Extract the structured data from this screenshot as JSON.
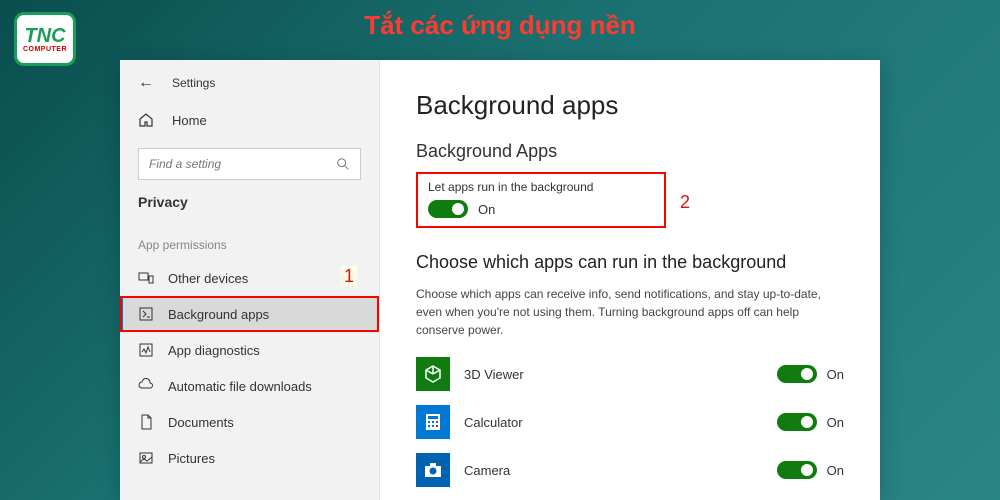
{
  "article": {
    "title": "Tắt các ứng dụng nền",
    "logo_main": "TNC",
    "logo_sub": "COMPUTER"
  },
  "annotations": {
    "step1": "1",
    "step2": "2"
  },
  "sidebar": {
    "back_label": "Settings",
    "home_label": "Home",
    "search_placeholder": "Find a setting",
    "category": "Privacy",
    "section": "App permissions",
    "items": [
      {
        "label": "Other devices"
      },
      {
        "label": "Background apps"
      },
      {
        "label": "App diagnostics"
      },
      {
        "label": "Automatic file downloads"
      },
      {
        "label": "Documents"
      },
      {
        "label": "Pictures"
      }
    ]
  },
  "main": {
    "title": "Background apps",
    "subsection": "Background Apps",
    "toggle_label": "Let apps run in the background",
    "toggle_state": "On",
    "choose_title": "Choose which apps can run in the background",
    "choose_desc": "Choose which apps can receive info, send notifications, and stay up-to-date, even when you're not using them. Turning background apps off can help conserve power.",
    "apps": [
      {
        "name": "3D Viewer",
        "state": "On"
      },
      {
        "name": "Calculator",
        "state": "On"
      },
      {
        "name": "Camera",
        "state": "On"
      }
    ]
  }
}
